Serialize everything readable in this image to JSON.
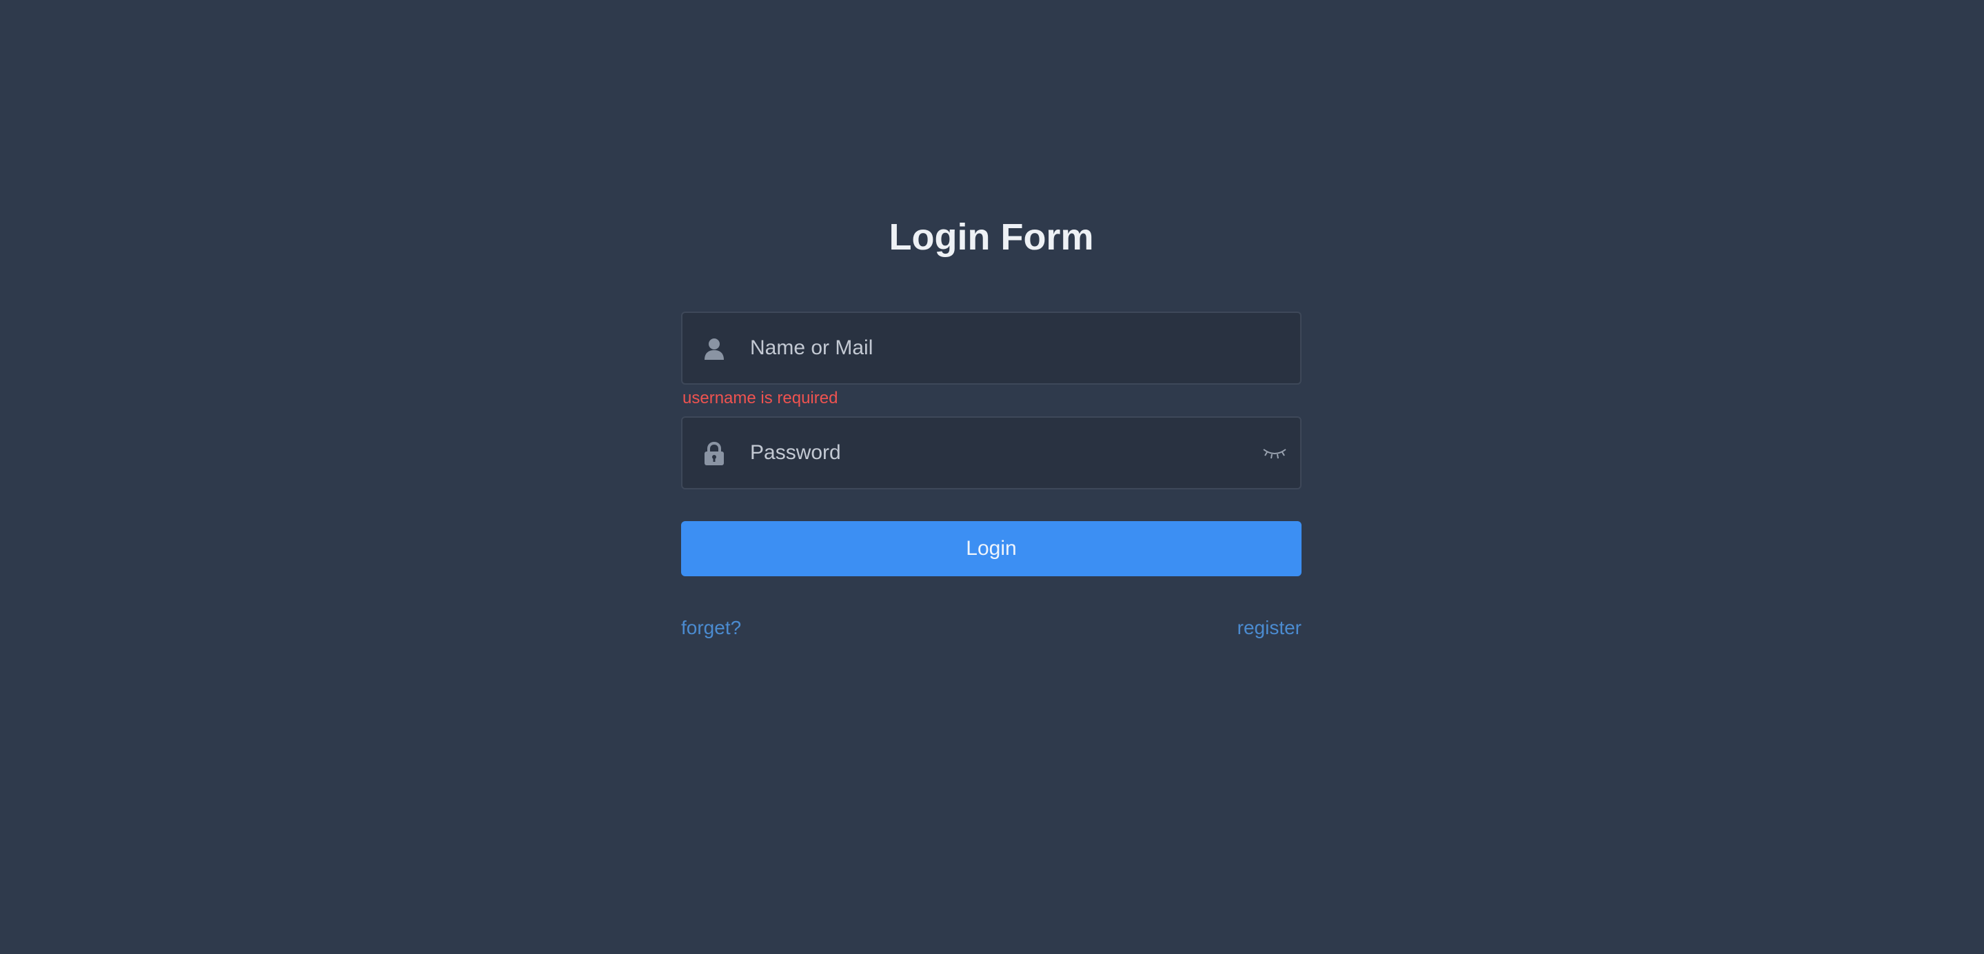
{
  "form": {
    "title": "Login Form",
    "username": {
      "placeholder": "Name or Mail",
      "value": "",
      "icon": "user-icon",
      "error": "username is required"
    },
    "password": {
      "placeholder": "Password",
      "value": "",
      "icon": "lock-icon",
      "toggle_icon": "eye-closed-icon"
    },
    "login_label": "Login",
    "forget_label": "forget?",
    "register_label": "register"
  },
  "colors": {
    "background": "#2f3a4c",
    "input_background": "#293241",
    "primary": "#3c8ff3",
    "error": "#ef5350",
    "link": "#4b8bd0"
  }
}
